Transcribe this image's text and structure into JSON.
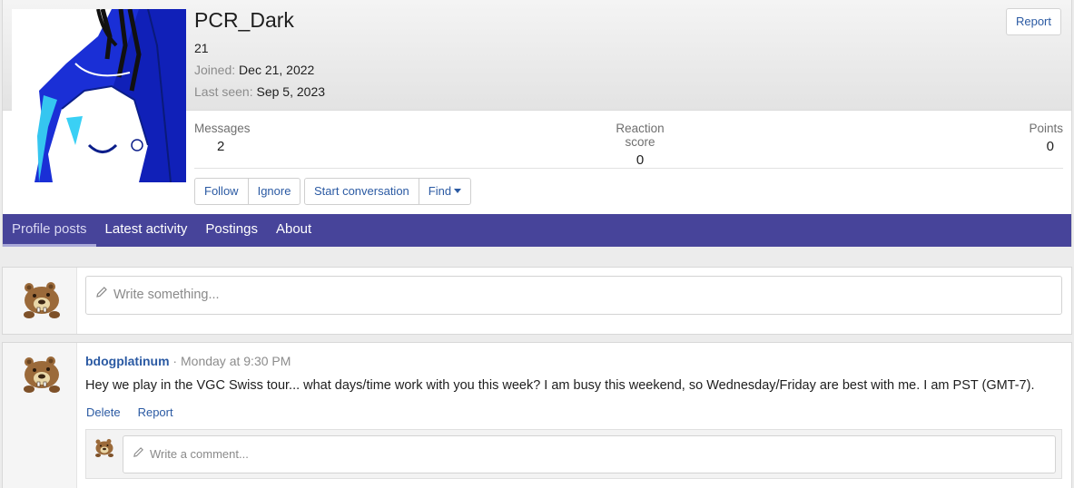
{
  "profile": {
    "username": "PCR_Dark",
    "user_title": "21",
    "joined_label": "Joined:",
    "joined_value": "Dec 21, 2022",
    "last_seen_label": "Last seen:",
    "last_seen_value": "Sep 5, 2023",
    "report_label": "Report",
    "avatar_icon": "anime-character-avatar"
  },
  "stats": {
    "messages_label": "Messages",
    "messages_value": "2",
    "reaction_label": "Reaction score",
    "reaction_value": "0",
    "points_label": "Points",
    "points_value": "0"
  },
  "actions": {
    "follow": "Follow",
    "ignore": "Ignore",
    "start_conversation": "Start conversation",
    "find": "Find"
  },
  "tabs": [
    {
      "label": "Profile posts",
      "active": true
    },
    {
      "label": "Latest activity",
      "active": false
    },
    {
      "label": "Postings",
      "active": false
    },
    {
      "label": "About",
      "active": false
    }
  ],
  "composer": {
    "placeholder": "Write something...",
    "avatar_icon": "bear-pokemon-avatar"
  },
  "post": {
    "author": "bdogplatinum",
    "separator": " · ",
    "time": "Monday at 9:30 PM",
    "body": "Hey we play in the VGC Swiss tour... what days/time work with you this week? I am busy this weekend, so Wednesday/Friday are best with me. I am PST (GMT-7).",
    "delete_label": "Delete",
    "report_label": "Report",
    "comment_placeholder": "Write a comment..."
  },
  "colors": {
    "tab_bar": "#47449a",
    "link": "#2b5aa3"
  }
}
